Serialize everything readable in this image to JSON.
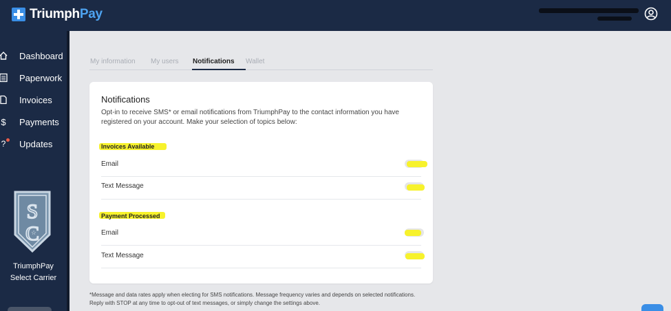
{
  "header": {
    "brand_main": "Triumph",
    "brand_accent": "Pay",
    "brand_color": "#4ea3f0",
    "bar_color": "#1b2a45",
    "account_icon": "user-circle-icon"
  },
  "sidebar": {
    "items": [
      {
        "label": "Dashboard",
        "icon": "home-icon"
      },
      {
        "label": "Paperwork",
        "icon": "document-list-icon"
      },
      {
        "label": "Invoices",
        "icon": "file-icon"
      },
      {
        "label": "Payments",
        "icon": "dollar-icon"
      },
      {
        "label": "Updates",
        "icon": "question-bell-icon"
      }
    ],
    "badge_logo": "select-carrier-shield-icon",
    "brand_line1": "TriumphPay",
    "brand_line2": "Select Carrier"
  },
  "tabs": [
    {
      "label": "My information",
      "active": false
    },
    {
      "label": "My users",
      "active": false
    },
    {
      "label": "Notifications",
      "active": true
    },
    {
      "label": "Wallet",
      "active": false
    }
  ],
  "card": {
    "title": "Notifications",
    "description": "Opt-in to receive SMS* or email notifications from TriumphPay to the contact information you have registered on your account. Make your selection of topics below:",
    "sections": [
      {
        "heading": "Invoices Available",
        "rows": [
          {
            "label": "Email",
            "enabled": false
          },
          {
            "label": "Text Message",
            "enabled": false
          }
        ]
      },
      {
        "heading": "Payment Processed",
        "rows": [
          {
            "label": "Email",
            "enabled": false
          },
          {
            "label": "Text Message",
            "enabled": false
          }
        ]
      }
    ]
  },
  "footnote": "*Message and data rates apply when electing for SMS notifications. Message frequency varies and depends on selected notifications. Reply with STOP at any time to opt-out of text messages, or simply change the settings above.",
  "highlight_color": "#f7f22c"
}
